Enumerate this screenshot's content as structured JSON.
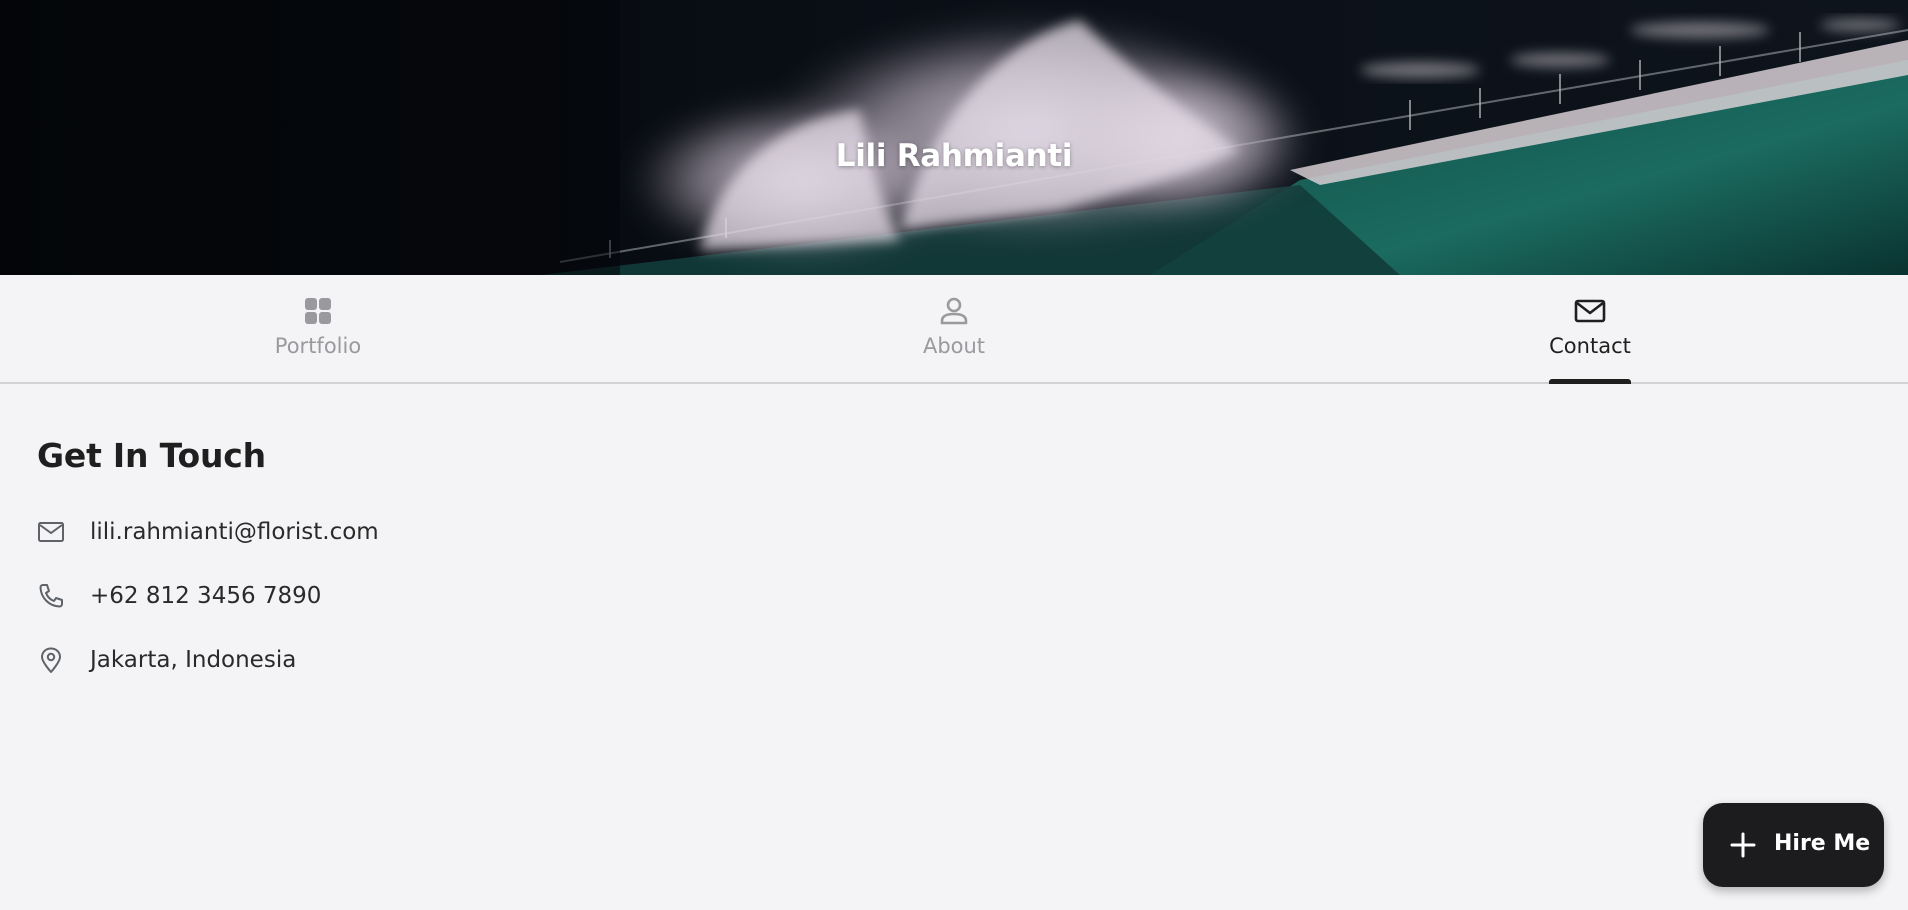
{
  "header": {
    "title": "Lili Rahmianti",
    "image": "ocean-wave-night-photo"
  },
  "tabs": [
    {
      "label": "Portfolio",
      "icon": "grid-icon",
      "active": false
    },
    {
      "label": "About",
      "icon": "person-icon",
      "active": false
    },
    {
      "label": "Contact",
      "icon": "mail-icon",
      "active": true
    }
  ],
  "contact": {
    "title": "Get In Touch",
    "email": "lili.rahmianti@florist.com",
    "phone": "+62 812 3456 7890",
    "location": "Jakarta, Indonesia"
  },
  "fab": {
    "label": "Hire Me",
    "icon": "plus-icon"
  },
  "colors": {
    "background": "#f4f4f6",
    "accent": "#1c1c1e",
    "inactive_tab": "#9a9a9e"
  }
}
